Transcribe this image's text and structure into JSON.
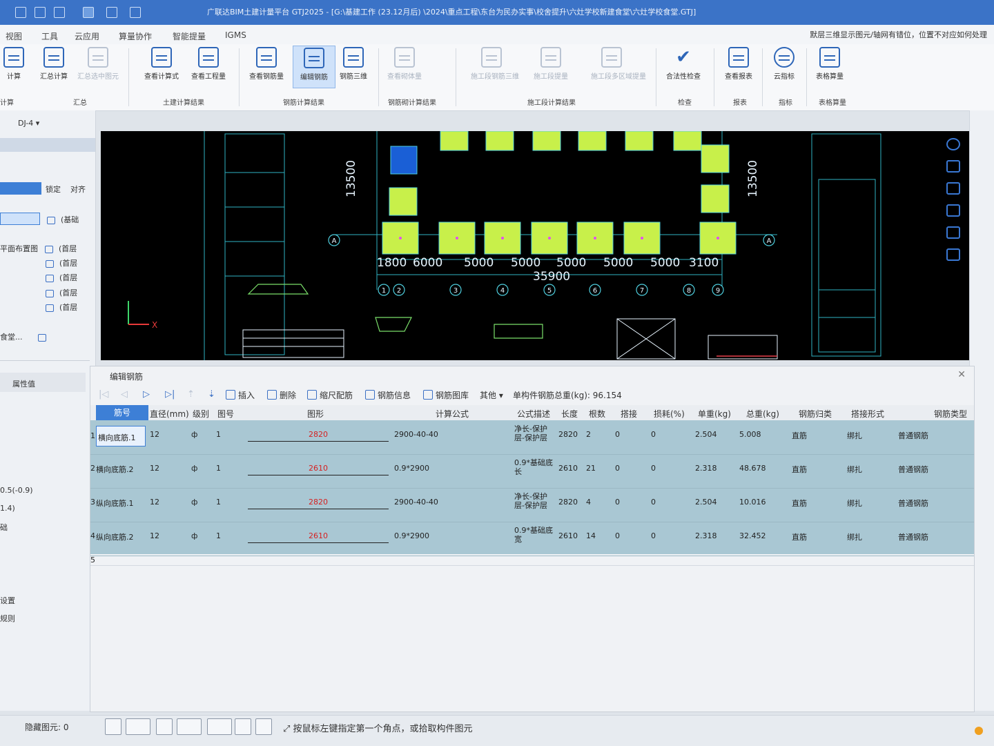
{
  "window": {
    "title": "广联达BIM土建计量平台 GTJ2025 - [G:\\基建工作 (23.12月后) \\2024\\重点工程\\东台为民办实事\\校舍提升\\六灶学校新建食堂\\六灶学校食堂.GTJ]"
  },
  "menu": {
    "items": [
      "视图",
      "工具",
      "云应用",
      "算量协作",
      "智能提量",
      "IGMS"
    ],
    "hint": "默层三维显示图元/轴网有错位，位置不对应如何处理"
  },
  "ribbon": {
    "buttons": [
      {
        "label": "汇总计算",
        "enabled": true
      },
      {
        "label": "汇总选中图元",
        "enabled": false
      },
      {
        "label": "查看计算式",
        "enabled": true
      },
      {
        "label": "查看工程量",
        "enabled": true
      },
      {
        "label": "查看钢筋量",
        "enabled": true
      },
      {
        "label": "编辑钢筋",
        "enabled": true,
        "active": true
      },
      {
        "label": "钢筋三维",
        "enabled": true
      },
      {
        "label": "查看砌体量",
        "enabled": false
      },
      {
        "label": "施工段钢筋三维",
        "enabled": false
      },
      {
        "label": "施工段提量",
        "enabled": false
      },
      {
        "label": "施工段多区域提量",
        "enabled": false
      },
      {
        "label": "合法性检查",
        "enabled": true
      },
      {
        "label": "查看报表",
        "enabled": true
      },
      {
        "label": "云指标",
        "enabled": true
      },
      {
        "label": "表格算量",
        "enabled": true
      }
    ],
    "groups": [
      "汇总",
      "土建计算结果",
      "钢筋计算结果",
      "钢筋砌计算结果",
      "施工段计算结果",
      "检查",
      "报表",
      "指标",
      "表格算量"
    ]
  },
  "left_panel": {
    "floor_selector": "DJ-4",
    "lock_label": "锁定",
    "align_label": "对齐",
    "base_layer": "(基础",
    "layers": [
      {
        "name": "平面布置图",
        "floor": "(首层"
      },
      {
        "name": "",
        "floor": "(首层"
      },
      {
        "name": "",
        "floor": "(首层"
      },
      {
        "name": "",
        "floor": "(首层"
      },
      {
        "name": "",
        "floor": "(首层"
      }
    ],
    "file_item": "食堂...",
    "property_header": "属性值",
    "property_values": [
      "0.5(-0.9)",
      "1.4)",
      "础"
    ],
    "settings_items": [
      "设置",
      "规则"
    ]
  },
  "viewport": {
    "dim_labels": [
      "1800",
      "6000",
      "5000",
      "5000",
      "5000",
      "5000",
      "5000",
      "3100"
    ],
    "total_length": "35900",
    "axis_left": "13500",
    "axis_right": "13500",
    "axis_grid_numbers": [
      "1",
      "2",
      "3",
      "4",
      "5",
      "6",
      "7",
      "8",
      "9"
    ],
    "axis_letter": "A"
  },
  "editor": {
    "title": "编辑钢筋",
    "toolbar": {
      "insert": "插入",
      "delete": "删除",
      "scale_rebar": "缩尺配筋",
      "rebar_info": "钢筋信息",
      "rebar_library": "钢筋图库",
      "other": "其他",
      "total_weight_label": "单构件钢筋总重(kg): 96.154"
    },
    "columns": [
      "筋号",
      "直径(mm)",
      "级别",
      "图号",
      "图形",
      "计算公式",
      "公式描述",
      "长度",
      "根数",
      "搭接",
      "损耗(%)",
      "单重(kg)",
      "总重(kg)",
      "钢筋归类",
      "搭接形式",
      "钢筋类型"
    ],
    "rows": [
      {
        "no": "1",
        "name": "横向底筋.1",
        "diameter": "12",
        "grade": "ф",
        "figure": "1",
        "shape": "2820",
        "formula": "2900-40-40",
        "desc": "净长-保护层-保护层",
        "length": "2820",
        "count": "2",
        "lap": "0",
        "loss": "0",
        "unit_weight": "2.504",
        "total_weight": "5.008",
        "category": "直筋",
        "lap_type": "绑扎",
        "type": "普通钢筋"
      },
      {
        "no": "2",
        "name": "横向底筋.2",
        "diameter": "12",
        "grade": "ф",
        "figure": "1",
        "shape": "2610",
        "formula": "0.9*2900",
        "desc": "0.9*基础底长",
        "length": "2610",
        "count": "21",
        "lap": "0",
        "loss": "0",
        "unit_weight": "2.318",
        "total_weight": "48.678",
        "category": "直筋",
        "lap_type": "绑扎",
        "type": "普通钢筋"
      },
      {
        "no": "3",
        "name": "纵向底筋.1",
        "diameter": "12",
        "grade": "ф",
        "figure": "1",
        "shape": "2820",
        "formula": "2900-40-40",
        "desc": "净长-保护层-保护层",
        "length": "2820",
        "count": "4",
        "lap": "0",
        "loss": "0",
        "unit_weight": "2.504",
        "total_weight": "10.016",
        "category": "直筋",
        "lap_type": "绑扎",
        "type": "普通钢筋"
      },
      {
        "no": "4",
        "name": "纵向底筋.2",
        "diameter": "12",
        "grade": "ф",
        "figure": "1",
        "shape": "2610",
        "formula": "0.9*2900",
        "desc": "0.9*基础底宽",
        "length": "2610",
        "count": "14",
        "lap": "0",
        "loss": "0",
        "unit_weight": "2.318",
        "total_weight": "32.452",
        "category": "直筋",
        "lap_type": "绑扎",
        "type": "普通钢筋"
      }
    ],
    "empty_row_no": "5"
  },
  "statusbar": {
    "hidden_label": "隐藏图元: 0",
    "hint": "按鼠标左键指定第一个角点，或拾取构件图元"
  }
}
